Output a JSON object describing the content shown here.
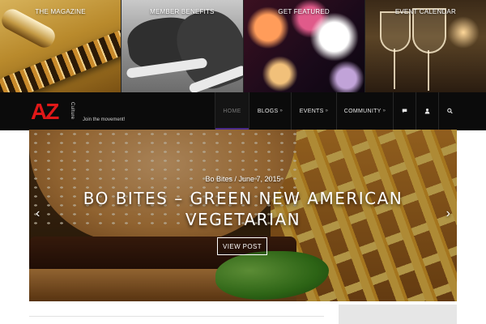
{
  "promo_tiles": [
    {
      "label": "THE MAGAZINE"
    },
    {
      "label": "MEMBER BENEFITS"
    },
    {
      "label": "GET FEATURED"
    },
    {
      "label": "EVENT CALENDAR"
    }
  ],
  "brand": {
    "logo_text": "AZ",
    "logo_subtext": "Culture",
    "tagline": "Join the movement!",
    "logo_color": "#e01818"
  },
  "nav": {
    "items": [
      {
        "label": "HOME",
        "active": true
      },
      {
        "label": "BLOGS",
        "dropdown": true
      },
      {
        "label": "EVENTS",
        "dropdown": true
      },
      {
        "label": "COMMUNITY",
        "dropdown": true
      }
    ],
    "icons": [
      {
        "name": "chat-icon",
        "glyph": "💬"
      },
      {
        "name": "user-icon",
        "glyph": "👤"
      },
      {
        "name": "search-icon",
        "glyph": "🔍"
      }
    ],
    "dropdown_glyph": "»",
    "active_color": "#4a2a8a"
  },
  "hero": {
    "meta": "Bo Bites / June 7, 2015",
    "title": "BO BITES – GREEN NEW AMERICAN VEGETARIAN",
    "button_label": "VIEW POST",
    "prev_glyph": "‹",
    "next_glyph": "›"
  }
}
